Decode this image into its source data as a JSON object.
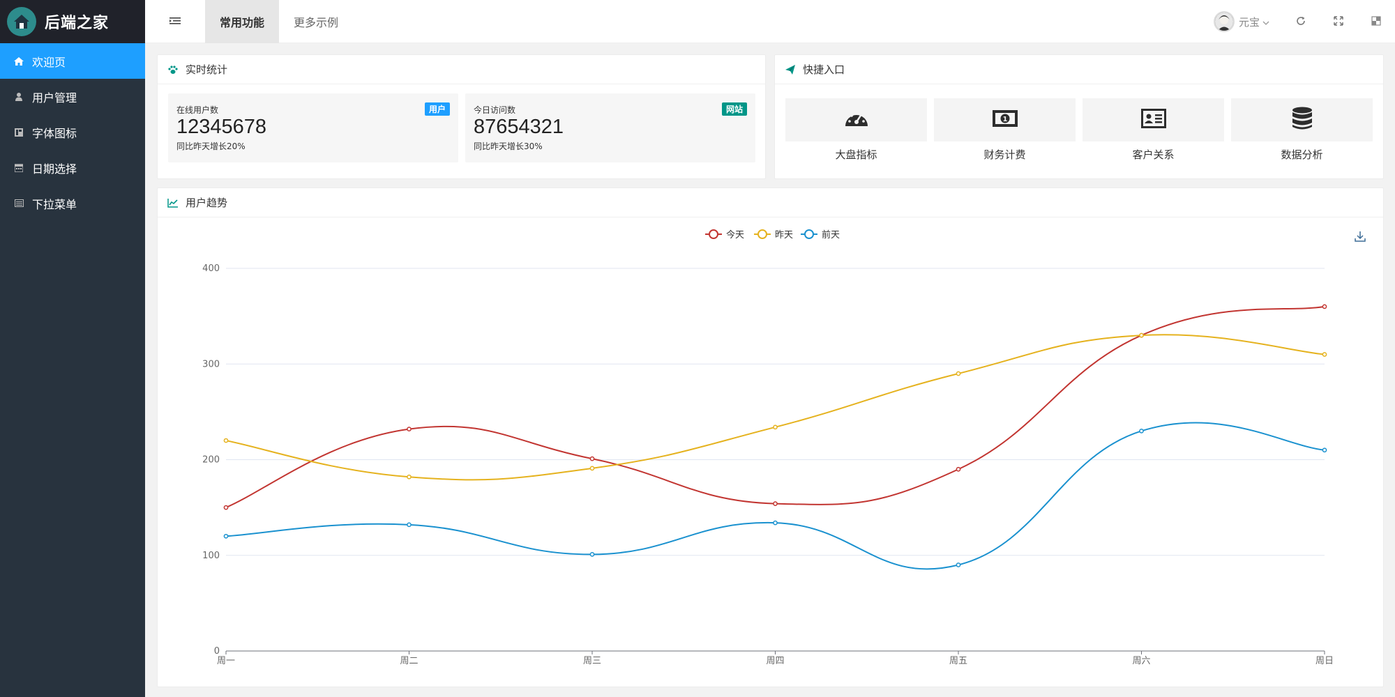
{
  "app": {
    "title": "后端之家"
  },
  "sidebar": {
    "items": [
      {
        "label": "欢迎页",
        "icon": "home-icon",
        "active": true
      },
      {
        "label": "用户管理",
        "icon": "user-icon",
        "active": false
      },
      {
        "label": "字体图标",
        "icon": "font-icon",
        "active": false
      },
      {
        "label": "日期选择",
        "icon": "calendar-icon",
        "active": false
      },
      {
        "label": "下拉菜单",
        "icon": "list-icon",
        "active": false
      }
    ]
  },
  "header": {
    "tabs": [
      {
        "label": "常用功能",
        "active": true
      },
      {
        "label": "更多示例",
        "active": false
      }
    ],
    "user_name": "元宝"
  },
  "stats_card": {
    "title": "实时统计",
    "items": [
      {
        "label": "在线用户数",
        "badge": "用户",
        "badge_color": "#1e9fff",
        "value": "12345678",
        "sub": "同比昨天增长20%"
      },
      {
        "label": "今日访问数",
        "badge": "网站",
        "badge_color": "#009688",
        "value": "87654321",
        "sub": "同比昨天增长30%"
      }
    ]
  },
  "quick_card": {
    "title": "快捷入口",
    "items": [
      {
        "label": "大盘指标",
        "icon": "dashboard-icon"
      },
      {
        "label": "财务计费",
        "icon": "money-icon"
      },
      {
        "label": "客户关系",
        "icon": "id-card-icon"
      },
      {
        "label": "数据分析",
        "icon": "database-icon"
      }
    ]
  },
  "trend_card": {
    "title": "用户趋势"
  },
  "chart_data": {
    "type": "line",
    "smooth": true,
    "categories": [
      "周一",
      "周二",
      "周三",
      "周四",
      "周五",
      "周六",
      "周日"
    ],
    "series": [
      {
        "name": "今天",
        "color": "#c23531",
        "values": [
          150,
          232,
          201,
          154,
          190,
          330,
          360
        ]
      },
      {
        "name": "昨天",
        "color": "#e5b21e",
        "values": [
          220,
          182,
          191,
          234,
          290,
          330,
          310
        ]
      },
      {
        "name": "前天",
        "color": "#1a91cf",
        "values": [
          120,
          132,
          101,
          134,
          90,
          230,
          210
        ]
      }
    ],
    "ylim": [
      0,
      400
    ],
    "yticks": [
      0,
      100,
      200,
      300,
      400
    ],
    "grid": true,
    "legend": "top-center"
  }
}
